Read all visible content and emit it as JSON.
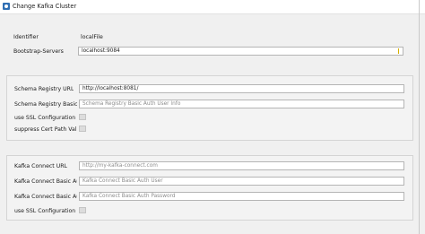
{
  "window": {
    "title": "Change Kafka Cluster"
  },
  "general": {
    "identifier_label": "Identifier",
    "identifier_value": "localFile",
    "bootstrap_label": "Bootstrap-Servers",
    "bootstrap_value": "localhost:9084"
  },
  "schema_registry": {
    "url_label": "Schema Registry URL",
    "url_value": "http://localhost:8081/",
    "auth_label": "Schema Registry Basic Auth ...",
    "auth_placeholder": "Schema Registry Basic Auth User Info",
    "ssl_label": "use SSL Configuration",
    "ssl_checked": false,
    "cert_label": "suppress Cert Path Validati...",
    "cert_checked": false
  },
  "kafka_connect": {
    "url_label": "Kafka Connect URL",
    "url_placeholder": "http://my-kafka-connect.com",
    "user_label": "Kafka Connect Basic Auth ...",
    "user_placeholder": "Kafka Connect Basic Auth User",
    "pass_label": "Kafka Connect Basic Auth ...",
    "pass_placeholder": "Kafka Connect Basic Auth Password",
    "ssl_label": "use SSL Configuration",
    "ssl_checked": false
  },
  "colors": {
    "accent_caret": "#d6b000",
    "app_icon": "#2f6fb4"
  }
}
